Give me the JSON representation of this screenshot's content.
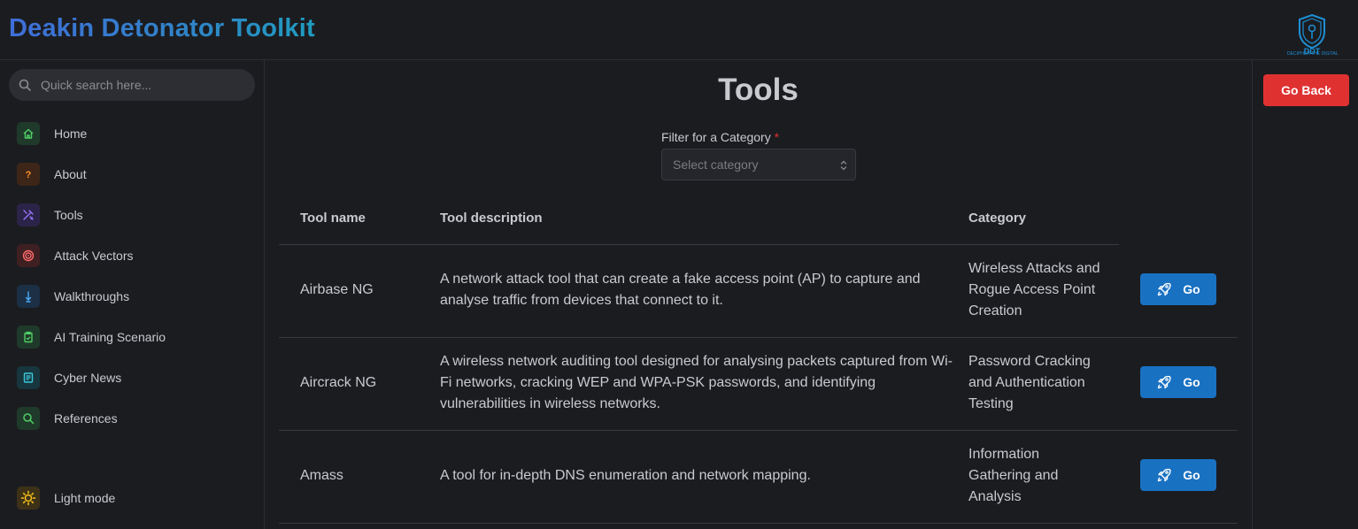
{
  "header": {
    "title": "Deakin Detonator Toolkit",
    "logo_text": "DDT",
    "logo_caption": "DECIPHER THE DIGITAL WORLD"
  },
  "search": {
    "placeholder": "Quick search here..."
  },
  "sidebar": {
    "items": [
      {
        "label": "Home",
        "icon": "home-icon",
        "color": "#37b24d"
      },
      {
        "label": "About",
        "icon": "question-icon",
        "color": "#f76707"
      },
      {
        "label": "Tools",
        "icon": "tools-icon",
        "color": "#7950f2"
      },
      {
        "label": "Attack Vectors",
        "icon": "target-icon",
        "color": "#f03e3e"
      },
      {
        "label": "Walkthroughs",
        "icon": "walkthrough-icon",
        "color": "#1c7ed6"
      },
      {
        "label": "AI Training Scenario",
        "icon": "clipboard-icon",
        "color": "#37b24d"
      },
      {
        "label": "Cyber News",
        "icon": "news-icon",
        "color": "#15aabf"
      },
      {
        "label": "References",
        "icon": "search-icon",
        "color": "#37b24d"
      }
    ],
    "theme_toggle": {
      "label": "Light mode",
      "icon": "sun-icon",
      "color": "#fab005"
    }
  },
  "main": {
    "title": "Tools",
    "filter": {
      "label": "Filter for a Category",
      "required_mark": "*",
      "placeholder": "Select category"
    },
    "table": {
      "headers": [
        "Tool name",
        "Tool description",
        "Category"
      ],
      "rows": [
        {
          "name": "Airbase NG",
          "description": "A network attack tool that can create a fake access point (AP) to capture and analyse traffic from devices that connect to it.",
          "category": "Wireless Attacks and Rogue Access Point Creation",
          "action": "Go"
        },
        {
          "name": "Aircrack NG",
          "description": "A wireless network auditing tool designed for analysing packets captured from Wi-Fi networks, cracking WEP and WPA-PSK passwords, and identifying vulnerabilities in wireless networks.",
          "category": "Password Cracking and Authentication Testing",
          "action": "Go"
        },
        {
          "name": "Amass",
          "description": "A tool for in-depth DNS enumeration and network mapping.",
          "category": "Information Gathering and Analysis",
          "action": "Go"
        }
      ]
    }
  },
  "actions": {
    "go_back": "Go Back"
  },
  "colors": {
    "background": "#1b1c20",
    "accent_blue": "#1971c2",
    "danger_red": "#e03131",
    "title_gradient": [
      "#3f6ed8",
      "#1f9cc0"
    ]
  }
}
